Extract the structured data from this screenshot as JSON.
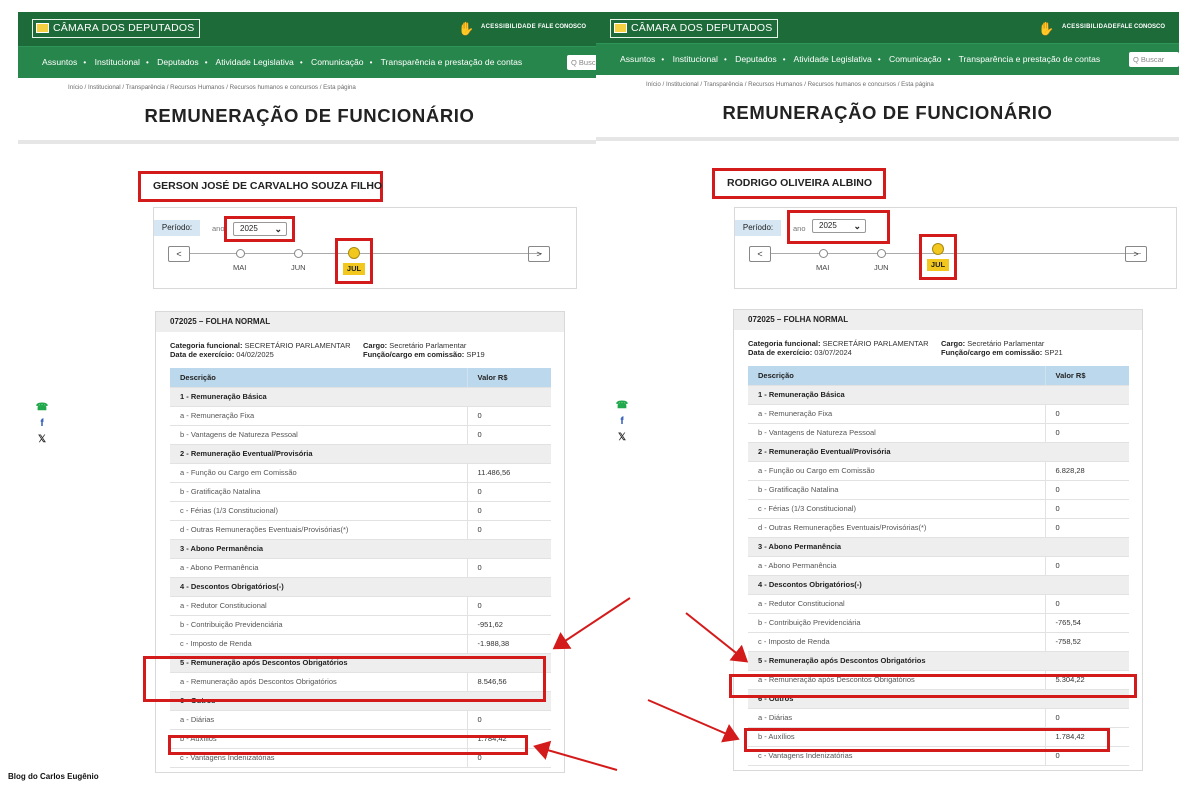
{
  "site": {
    "logo": "CÂMARA DOS DEPUTADOS",
    "accessibility": "ACESSIBILIDADE",
    "contact": "FALE CONOSCO",
    "nav": [
      "Assuntos",
      "Institucional",
      "Deputados",
      "Atividade Legislativa",
      "Comunicação",
      "Transparência e prestação de contas"
    ],
    "search_left": "Q Busc",
    "search_right": "Q Buscar",
    "breadcrumb": "Início  /  Institucional  /  Transparência  /  Recursos Humanos  /  Recursos humanos e concursos  /  Esta página",
    "page_title": "REMUNERAÇÃO DE FUNCIONÁRIO"
  },
  "labels": {
    "period": "Período:",
    "ano": "ano",
    "months": [
      "MAI",
      "JUN",
      "JUL"
    ],
    "prev": "<",
    "next": ">",
    "col_desc": "Descrição",
    "col_val": "Valor R$",
    "categoria": "Categoria funcional:",
    "data_exercicio": "Data de exercício:",
    "cargo": "Cargo:",
    "funcao": "Função/cargo em comissão:"
  },
  "left": {
    "name": "GERSON JOSÉ DE CARVALHO SOUZA FILHO",
    "year": "2025",
    "sheet_title": "072025 – FOLHA NORMAL",
    "categoria": "SECRETÁRIO PARLAMENTAR",
    "data_exercicio": "04/02/2025",
    "cargo": "Secretário Parlamentar",
    "funcao": "SP19",
    "values": {
      "a_fixa": "0",
      "b_vantagens": "0",
      "a_funcao": "11.486,56",
      "b_grat": "0",
      "c_ferias": "0",
      "d_outras": "0",
      "a_abono": "0",
      "a_redutor": "0",
      "b_contrib": "-951,62",
      "c_ir": "-1.988,38",
      "a_apos": "8.546,56",
      "a_diarias": "0",
      "b_aux": "1.784,42",
      "c_vant": "0"
    }
  },
  "right": {
    "name": "RODRIGO OLIVEIRA ALBINO",
    "year": "2025",
    "sheet_title": "072025 – FOLHA NORMAL",
    "categoria": "SECRETÁRIO PARLAMENTAR",
    "data_exercicio": "03/07/2024",
    "cargo": "Secretário Parlamentar",
    "funcao": "SP21",
    "values": {
      "a_fixa": "0",
      "b_vantagens": "0",
      "a_funcao": "6.828,28",
      "b_grat": "0",
      "c_ferias": "0",
      "d_outras": "0",
      "a_abono": "0",
      "a_redutor": "0",
      "b_contrib": "-765,54",
      "c_ir": "-758,52",
      "a_apos": "5.304,22",
      "a_diarias": "0",
      "b_aux": "1.784,42",
      "c_vant": "0"
    }
  },
  "rows": {
    "s1": "1 - Remuneração Básica",
    "a_fixa": "a - Remuneração Fixa",
    "b_vantagens": "b - Vantagens de Natureza Pessoal",
    "s2": "2 - Remuneração Eventual/Provisória",
    "a_funcao": "a - Função ou Cargo em Comissão",
    "b_grat": "b - Gratificação Natalina",
    "c_ferias": "c - Férias (1/3 Constitucional)",
    "d_outras": "d - Outras Remunerações Eventuais/Provisórias(*)",
    "s3": "3 - Abono Permanência",
    "a_abono": "a - Abono Permanência",
    "s4": "4 - Descontos Obrigatórios(-)",
    "a_redutor": "a - Redutor Constitucional",
    "b_contrib": "b - Contribuição Previdenciária",
    "c_ir": "c - Imposto de Renda",
    "s5": "5 - Remuneração após Descontos Obrigatórios",
    "a_apos": "a - Remuneração após Descontos Obrigatórios",
    "s6": "6 - Outros",
    "a_diarias": "a - Diárias",
    "b_aux": "b - Auxílios",
    "c_vant": "c - Vantagens Indenizatórias"
  },
  "share": {
    "whatsapp": "☎",
    "facebook": "f",
    "x": "𝕏"
  },
  "credit": "Blog do Carlos Eugênio",
  "colors": {
    "topbar": "#1e6b3a",
    "navbar": "#27864c",
    "highlight": "#d41b1b",
    "active_month": "#f2c81e",
    "table_header": "#bcd8ec"
  }
}
